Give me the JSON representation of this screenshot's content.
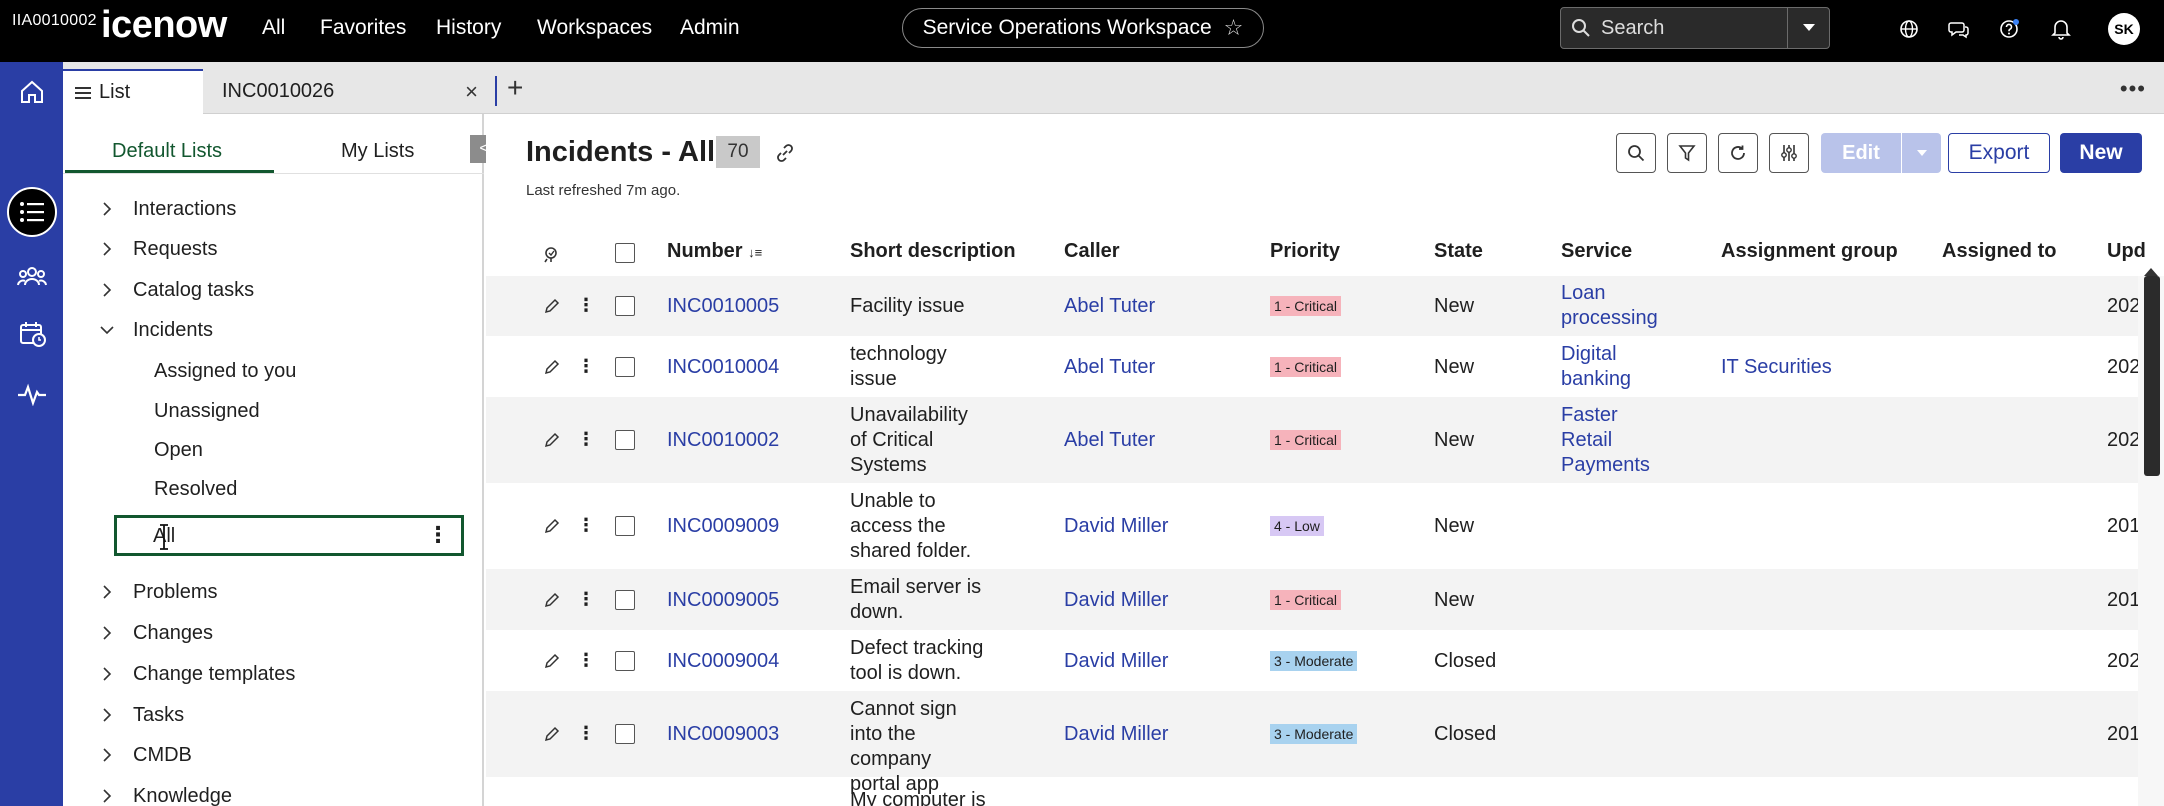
{
  "header": {
    "instance_id": "IIA0010002",
    "logo_text": "icenow",
    "nav": [
      "All",
      "Favorites",
      "History",
      "Workspaces",
      "Admin"
    ],
    "workspace": "Service Operations Workspace",
    "search_placeholder": "Search",
    "avatar_initials": "SK",
    "icons": [
      "globe-icon",
      "chat-icon",
      "help-icon",
      "bell-icon"
    ]
  },
  "tabs": {
    "list_label": "List",
    "record_label": "INC0010026"
  },
  "sidepanel": {
    "tab_default": "Default Lists",
    "tab_my": "My Lists",
    "collapse_glyph": "<",
    "items": [
      {
        "label": "Interactions",
        "expanded": false
      },
      {
        "label": "Requests",
        "expanded": false
      },
      {
        "label": "Catalog tasks",
        "expanded": false
      },
      {
        "label": "Incidents",
        "expanded": true
      },
      {
        "label": "Problems",
        "expanded": false
      },
      {
        "label": "Changes",
        "expanded": false
      },
      {
        "label": "Change templates",
        "expanded": false
      },
      {
        "label": "Tasks",
        "expanded": false
      },
      {
        "label": "CMDB",
        "expanded": false
      },
      {
        "label": "Knowledge",
        "expanded": false
      }
    ],
    "incident_children": [
      "Assigned to you",
      "Unassigned",
      "Open",
      "Resolved"
    ],
    "selected_child": "All"
  },
  "main": {
    "title": "Incidents - All",
    "count": "70",
    "last_refreshed": "Last refreshed 7m ago.",
    "edit_label": "Edit",
    "export_label": "Export",
    "new_label": "New",
    "columns": [
      "Number",
      "Short description",
      "Caller",
      "Priority",
      "State",
      "Service",
      "Assignment group",
      "Assigned to",
      "Upd"
    ],
    "sort_glyph": "↓≡",
    "rows": [
      {
        "number": "INC0010005",
        "desc": "Facility issue",
        "caller": "Abel Tuter",
        "priority": "1 - Critical",
        "priority_level": "critical",
        "state": "New",
        "service": "Loan processing",
        "group": "",
        "assigned": "",
        "updated": "202"
      },
      {
        "number": "INC0010004",
        "desc": "technology issue",
        "caller": "Abel Tuter",
        "priority": "1 - Critical",
        "priority_level": "critical",
        "state": "New",
        "service": "Digital banking",
        "group": "IT Securities",
        "assigned": "",
        "updated": "202"
      },
      {
        "number": "INC0010002",
        "desc": "Unavailability of Critical Systems",
        "caller": "Abel Tuter",
        "priority": "1 - Critical",
        "priority_level": "critical",
        "state": "New",
        "service": "Faster Retail Payments",
        "group": "",
        "assigned": "",
        "updated": "202"
      },
      {
        "number": "INC0009009",
        "desc": "Unable to access the shared folder.",
        "caller": "David Miller",
        "priority": "4 - Low",
        "priority_level": "low",
        "state": "New",
        "service": "",
        "group": "",
        "assigned": "",
        "updated": "201"
      },
      {
        "number": "INC0009005",
        "desc": "Email server is down.",
        "caller": "David Miller",
        "priority": "1 - Critical",
        "priority_level": "critical",
        "state": "New",
        "service": "",
        "group": "",
        "assigned": "",
        "updated": "201"
      },
      {
        "number": "INC0009004",
        "desc": "Defect tracking tool is down.",
        "caller": "David Miller",
        "priority": "3 - Moderate",
        "priority_level": "moderate",
        "state": "Closed",
        "service": "",
        "group": "",
        "assigned": "",
        "updated": "202"
      },
      {
        "number": "INC0009003",
        "desc": "Cannot sign into the company portal app",
        "caller": "David Miller",
        "priority": "3 - Moderate",
        "priority_level": "moderate",
        "state": "Closed",
        "service": "",
        "group": "",
        "assigned": "",
        "updated": "201"
      },
      {
        "number": "",
        "desc": "My computer is",
        "caller": "",
        "priority": "",
        "priority_level": "",
        "state": "",
        "service": "",
        "group": "",
        "assigned": "",
        "updated": ""
      }
    ]
  },
  "colors": {
    "rail": "#2a3ea5",
    "accent_green": "#12572f",
    "link_blue": "#2a3ea5",
    "critical": "#f6b3bb",
    "low": "#d7c8f4",
    "moderate": "#a8d2ef"
  }
}
